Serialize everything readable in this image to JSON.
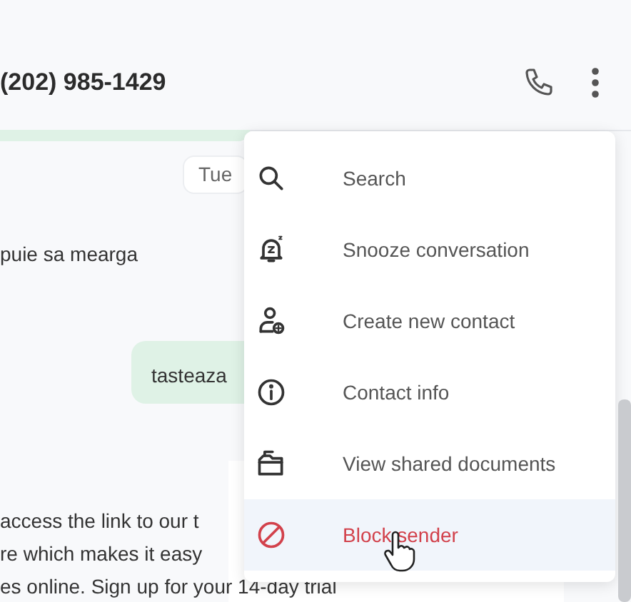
{
  "header": {
    "title": "(202) 985-1429"
  },
  "messages": [
    {
      "kind": "date",
      "text": "Tue"
    },
    {
      "kind": "incoming",
      "text": "puie sa mearga"
    },
    {
      "kind": "outgoing",
      "text": "tasteaza"
    },
    {
      "kind": "incoming",
      "lines": [
        "access the link to our t",
        "re which makes it easy",
        "es online. Sign up for your 14-day trial"
      ]
    }
  ],
  "menu": [
    {
      "label": "Search",
      "kind": "normal",
      "selected": false
    },
    {
      "label": "Snooze conversation",
      "kind": "normal",
      "selected": false
    },
    {
      "label": "Create new contact",
      "kind": "normal",
      "selected": false
    },
    {
      "label": "Contact info",
      "kind": "normal",
      "selected": false
    },
    {
      "label": "View shared documents",
      "kind": "normal",
      "selected": false
    },
    {
      "label": "Block sender",
      "kind": "danger",
      "selected": true
    }
  ]
}
